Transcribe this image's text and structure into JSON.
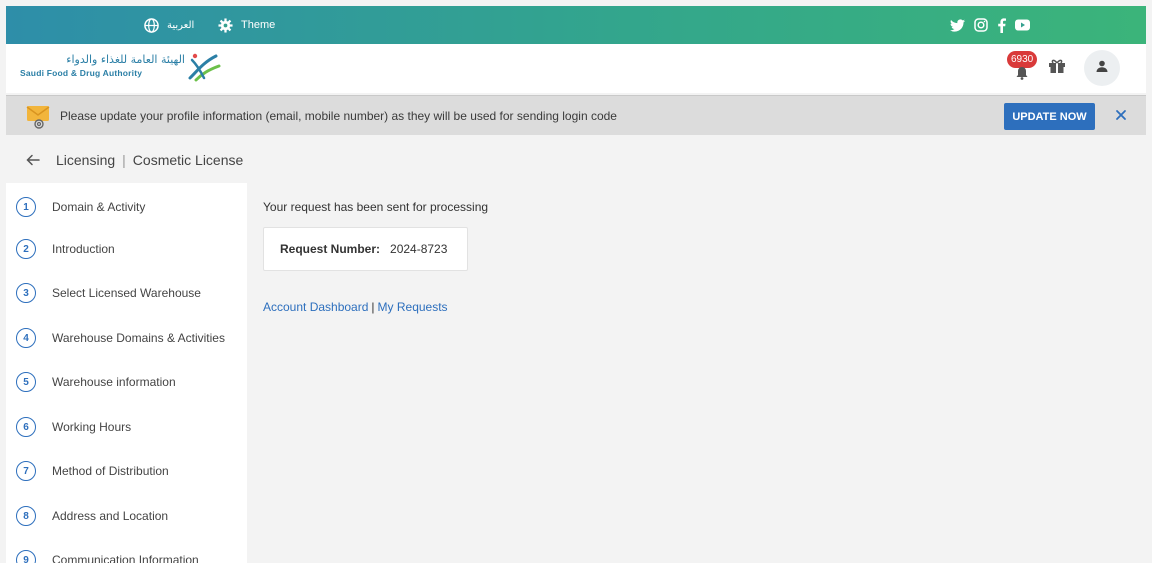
{
  "topbar": {
    "language_label": "العربية",
    "theme_label": "Theme",
    "icons": [
      "globe-icon",
      "gear-icon",
      "twitter-icon",
      "instagram-icon",
      "facebook-icon",
      "youtube-icon"
    ]
  },
  "header": {
    "logo_arabic": "الهيئة العامة للغذاء والدواء",
    "logo_english": "Saudi Food & Drug Authority",
    "notification_count": "6930",
    "icons": [
      "bell-icon",
      "gift-icon",
      "user-icon"
    ]
  },
  "alert": {
    "message": "Please update your profile information (email, mobile number) as they will be used for sending login code",
    "button_label": "UPDATE NOW"
  },
  "breadcrumb": {
    "section": "Licensing",
    "page": "Cosmetic License"
  },
  "steps": [
    {
      "num": "1",
      "label": "Domain & Activity"
    },
    {
      "num": "2",
      "label": "Introduction"
    },
    {
      "num": "3",
      "label": "Select Licensed Warehouse"
    },
    {
      "num": "4",
      "label": "Warehouse Domains & Activities"
    },
    {
      "num": "5",
      "label": "Warehouse information"
    },
    {
      "num": "6",
      "label": "Working Hours"
    },
    {
      "num": "7",
      "label": "Method of Distribution"
    },
    {
      "num": "8",
      "label": "Address and Location"
    },
    {
      "num": "9",
      "label": "Communication Information"
    }
  ],
  "main": {
    "status_text": "Your request has been sent for processing",
    "request_label": "Request Number:",
    "request_number": "2024-8723",
    "link_dashboard": "Account Dashboard",
    "link_separator": "|",
    "link_requests": "My Requests"
  },
  "colors": {
    "accent": "#2d6fbd",
    "topbar_start": "#2e8ea9",
    "topbar_end": "#3bb47a",
    "badge": "#d93a3a"
  }
}
